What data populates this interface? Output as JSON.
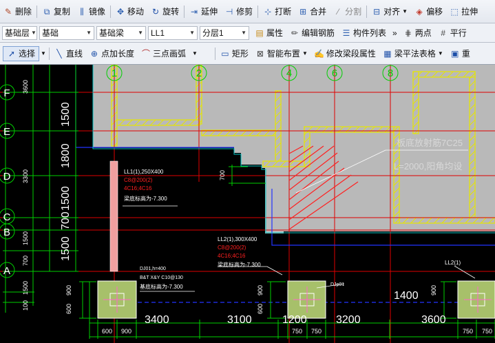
{
  "toolbar1": {
    "delete": "删除",
    "copy": "复制",
    "mirror": "镜像",
    "move": "移动",
    "rotate": "旋转",
    "extend": "延伸",
    "trim": "修剪",
    "break": "打断",
    "merge": "合并",
    "split": "分割",
    "align": "对齐",
    "offset": "偏移",
    "stretch": "拉伸"
  },
  "toolbar2": {
    "layer": "基础层",
    "category": "基础",
    "component_type": "基础梁",
    "component": "LL1",
    "sublayer": "分层1",
    "properties": "属性",
    "edit_rebar": "编辑钢筋",
    "component_list": "构件列表",
    "overflow": "»",
    "two_points": "两点",
    "parallel": "平行"
  },
  "toolbar3": {
    "select": "选择",
    "line": "直线",
    "point_length": "点加长度",
    "three_point_arc": "三点画弧",
    "rect": "矩形",
    "smart_layout": "智能布置",
    "modify_segment": "修改梁段属性",
    "beam_table": "梁平法表格",
    "more": "重"
  },
  "canvas": {
    "axis_top": [
      "1",
      "2",
      "4",
      "6",
      "8"
    ],
    "axis_left": [
      "F",
      "E",
      "D",
      "C",
      "B",
      "A"
    ],
    "dim_left": [
      "3600",
      "1500",
      "1800",
      "3300",
      "1500",
      "700",
      "1500",
      "1500",
      "700",
      "1500",
      "100"
    ],
    "dim_bottom": [
      "3400",
      "3100",
      "1200",
      "3200",
      "3600"
    ],
    "dim_inner": "1400",
    "note_rebar": "板底放射筋7C25",
    "note_length": "L=2000,阳角均设",
    "ll1": [
      "LL1(1),250X400",
      "C8@200(2)",
      "4C16;4C16",
      "梁底标高为-7.300"
    ],
    "ll2": [
      "LL2(1),300X400",
      "C8@200(2)",
      "4C16;4C16",
      "梁底标高为-7.300"
    ],
    "ll2b": "LL2(1)",
    "dj": [
      "DJ01,h=400",
      "B&T X&Y C10@130",
      "基底标高为-7.300"
    ],
    "dj_ref": "DJp01",
    "dim_small": [
      "700",
      "900",
      "900",
      "600",
      "600",
      "900",
      "750",
      "750",
      "900",
      "750",
      "750",
      "100"
    ]
  },
  "colors": {
    "slab": "#b9b9b9",
    "wall_hatch": "#e6e600",
    "grid_red": "#e00000",
    "dim_green": "#00d000",
    "beam_blue": "#2233ff",
    "footing": "#a7c06a",
    "hatch_red": "#ff2020"
  }
}
